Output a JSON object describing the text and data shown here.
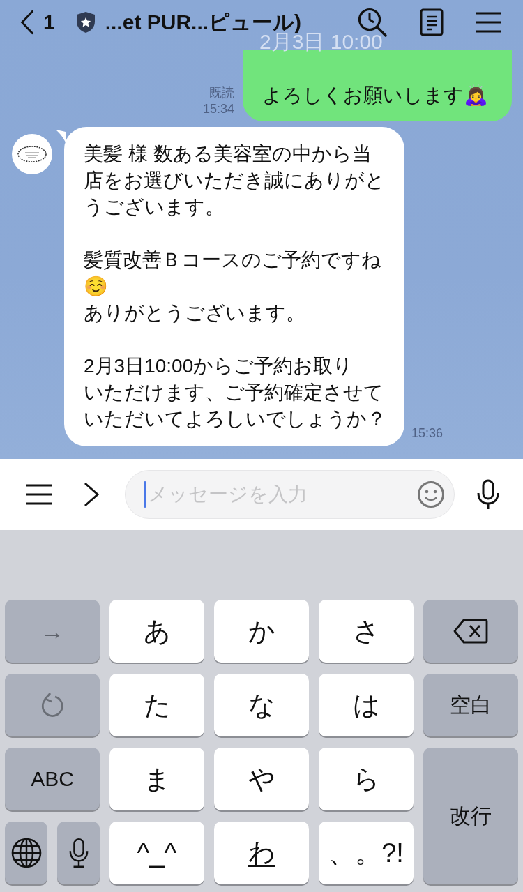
{
  "header": {
    "back_count": "1",
    "title": "...et PUR...ピュール)"
  },
  "ghost_date": "2月3日 10:00",
  "messages": [
    {
      "kind": "sent",
      "text": "よろしくお願いします🙇‍♀️",
      "read": "既読",
      "time": "15:34"
    },
    {
      "kind": "received",
      "paragraphs": [
        [
          "美髪 様 数ある美容室の中から当",
          "店をお選びいただき誠にありがと",
          "うございます。"
        ],
        [
          "髪質改善Ｂコースのご予約ですね",
          "☺️",
          "ありがとうございます。"
        ],
        [
          "2月3日10:00からご予約お取り",
          "いただけます、ご予約確定させて",
          "いただいてよろしいでしょうか？"
        ]
      ],
      "time": "15:36"
    }
  ],
  "input": {
    "placeholder": "メッセージを入力"
  },
  "keyboard": {
    "keys": [
      {
        "kind": "function",
        "label": "→"
      },
      {
        "kind": "kana",
        "label": "あ"
      },
      {
        "kind": "kana",
        "label": "か"
      },
      {
        "kind": "kana",
        "label": "さ"
      },
      {
        "kind": "delete"
      },
      {
        "kind": "undo"
      },
      {
        "kind": "kana",
        "label": "た"
      },
      {
        "kind": "kana",
        "label": "な"
      },
      {
        "kind": "kana",
        "label": "は"
      },
      {
        "kind": "side",
        "label": "空白"
      },
      {
        "kind": "function",
        "label": "ABC"
      },
      {
        "kind": "kana",
        "label": "ま"
      },
      {
        "kind": "kana",
        "label": "や"
      },
      {
        "kind": "kana",
        "label": "ら"
      },
      {
        "kind": "enter",
        "label": "改行"
      },
      {
        "kind": "globe"
      },
      {
        "kind": "mic"
      },
      {
        "kind": "kana",
        "label": "^_^"
      },
      {
        "kind": "small-kana",
        "label": "わ"
      },
      {
        "kind": "kana",
        "label": "、。?!"
      }
    ]
  }
}
